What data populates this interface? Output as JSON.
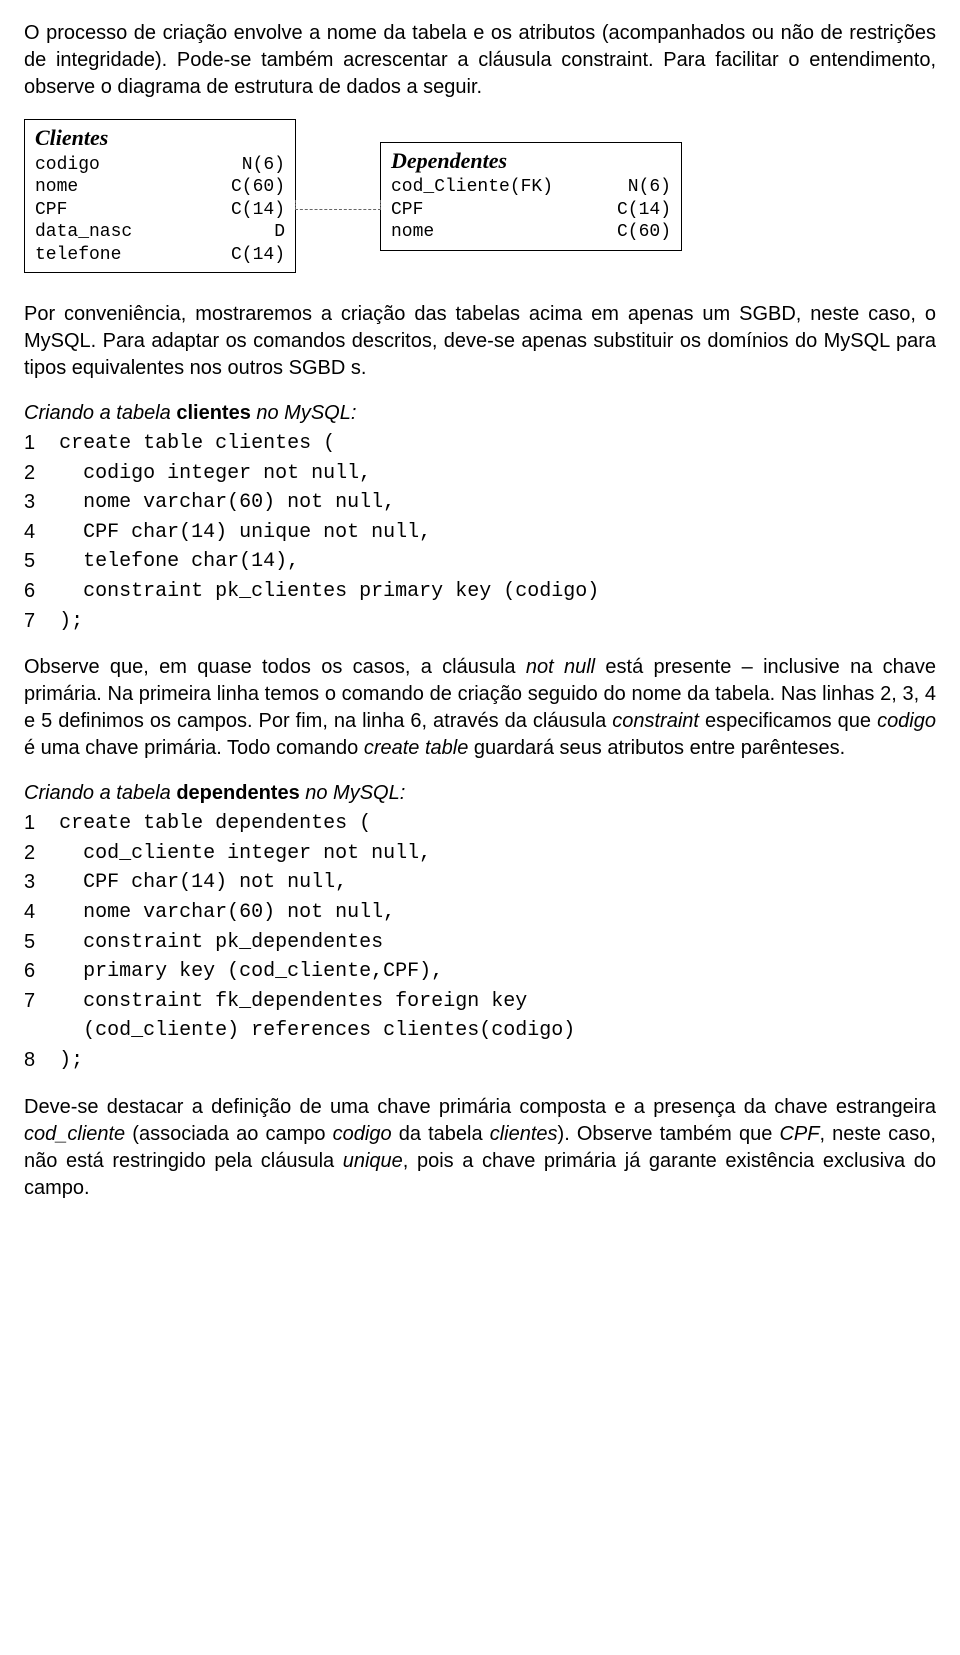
{
  "para1": "O processo de criação envolve a nome da tabela e os atributos (acompanhados ou não de restrições de integridade). Pode-se também acrescentar a cláusula constraint. Para facilitar o entendimento, observe o diagrama de estrutura de dados a seguir.",
  "diagram": {
    "clientes": {
      "title": "Clientes",
      "rows": [
        {
          "name": "codigo",
          "type": "N(6)"
        },
        {
          "name": "nome",
          "type": "C(60)"
        },
        {
          "name": "CPF",
          "type": "C(14)"
        },
        {
          "name": "data_nasc",
          "type": "D"
        },
        {
          "name": "telefone",
          "type": "C(14)"
        }
      ]
    },
    "dependentes": {
      "title": "Dependentes",
      "rows": [
        {
          "name": "cod_Cliente(FK)",
          "type": "N(6)"
        },
        {
          "name": "CPF",
          "type": "C(14)"
        },
        {
          "name": "nome",
          "type": "C(60)"
        }
      ]
    }
  },
  "para2": "Por conveniência, mostraremos a criação das tabelas acima em apenas um SGBD, neste caso, o MySQL. Para adaptar os comandos descritos, deve-se apenas substituir os domínios do MySQL para tipos equivalentes nos outros SGBD s.",
  "code1": {
    "heading_pre": "Criando a tabela ",
    "heading_bold": "clientes",
    "heading_post": " no MySQL:",
    "line_numbers": "1\n2\n3\n4\n5\n6\n7",
    "code": "create table clientes (\n  codigo integer not null,\n  nome varchar(60) not null,\n  CPF char(14) unique not null,\n  telefone char(14),\n  constraint pk_clientes primary key (codigo)\n);"
  },
  "para3_a": "Observe que, em quase todos os casos, a cláusula ",
  "para3_b": "not null",
  "para3_c": " está presente – inclusive na chave primária. Na primeira linha temos o comando de criação seguido do nome da tabela. Nas linhas 2, 3, 4 e 5 definimos os campos. Por fim, na linha 6, através da cláusula ",
  "para3_d": "constraint",
  "para3_e": " especificamos que ",
  "para3_f": "codigo",
  "para3_g": " é uma chave primária. Todo comando ",
  "para3_h": "create table",
  "para3_i": " guardará seus atributos entre parênteses.",
  "code2": {
    "heading_pre": "Criando a tabela ",
    "heading_bold": "dependentes",
    "heading_post": " no MySQL:",
    "line_numbers": "1\n2\n3\n4\n5\n6\n7\n\n8",
    "code": "create table dependentes (\n  cod_cliente integer not null,\n  CPF char(14) not null,\n  nome varchar(60) not null,\n  constraint pk_dependentes\n  primary key (cod_cliente,CPF),\n  constraint fk_dependentes foreign key\n  (cod_cliente) references clientes(codigo)\n);"
  },
  "para4_a": "Deve-se destacar a definição de uma chave primária composta e a presença da chave estrangeira ",
  "para4_b": "cod_cliente",
  "para4_c": " (associada ao campo ",
  "para4_d": "codigo",
  "para4_e": " da tabela ",
  "para4_f": "clientes",
  "para4_g": "). Observe também que ",
  "para4_h": "CPF",
  "para4_i": ", neste caso, não está restringido pela cláusula ",
  "para4_j": "unique",
  "para4_k": ", pois a chave primária já garante existência exclusiva do campo."
}
